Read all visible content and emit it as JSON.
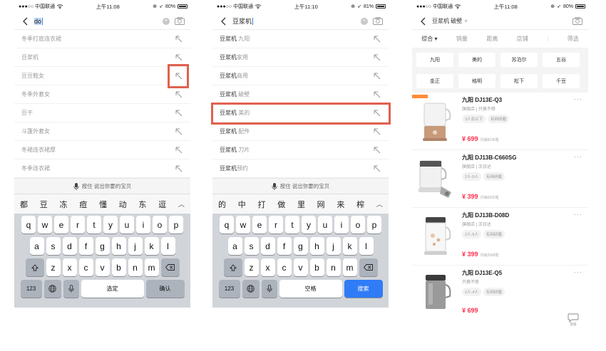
{
  "status": {
    "carrier": "●●●○○ 中国联通",
    "wifi": "wifi"
  },
  "screen1": {
    "time": "上午11:08",
    "battery_text": "80%",
    "battery_level": 0.8,
    "query_typed": "do",
    "suggestions": [
      "冬季打底连衣裙",
      "豆浆机",
      "豆豆鞋女",
      "冬季外套女",
      "豆干",
      "斗篷外套女",
      "冬裙连衣裙厚",
      "冬季连衣裙"
    ],
    "voice_label": "按住 说出你要的宝贝",
    "candidates": [
      "都",
      "豆",
      "冻",
      "痘",
      "懂",
      "动",
      "东",
      "逗"
    ],
    "confirm_label": "选定",
    "ok_label": "确认"
  },
  "screen2": {
    "time": "上午11:10",
    "battery_text": "81%",
    "battery_level": 0.81,
    "query_typed": "豆浆机",
    "suggestions": [
      {
        "kw": "豆浆机",
        "rest": " 九阳"
      },
      {
        "kw": "豆浆机",
        "rest": "家用"
      },
      {
        "kw": "豆浆机",
        "rest": "商用"
      },
      {
        "kw": "豆浆机",
        "rest": " 破壁"
      },
      {
        "kw": "豆浆机",
        "rest": " 美的"
      },
      {
        "kw": "豆浆机",
        "rest": " 配件"
      },
      {
        "kw": "豆浆机",
        "rest": " 刀片"
      },
      {
        "kw": "豆浆机",
        "rest": "预约"
      }
    ],
    "voice_label": "按住 说出你要的宝贝",
    "candidates": [
      "的",
      "中",
      "打",
      "做",
      "里",
      "网",
      "来",
      "榨"
    ],
    "space_label": "空格",
    "search_label": "搜索"
  },
  "keyboard": {
    "row1": [
      "q",
      "w",
      "e",
      "r",
      "t",
      "y",
      "u",
      "i",
      "o",
      "p"
    ],
    "row2": [
      "a",
      "s",
      "d",
      "f",
      "g",
      "h",
      "j",
      "k",
      "l"
    ],
    "row3": [
      "z",
      "x",
      "c",
      "v",
      "b",
      "n",
      "m"
    ],
    "num_label": "123"
  },
  "screen3": {
    "time": "上午11:08",
    "battery_text": "80%",
    "battery_level": 0.8,
    "search_tag": "豆浆机 破壁",
    "sort": [
      "综合 ▾",
      "销量",
      "距离",
      "店铺",
      "筛选"
    ],
    "filters": [
      "九阳",
      "美的",
      "苏泊尔",
      "五谷",
      "金正",
      "格明",
      "松下",
      "千豆"
    ],
    "products": [
      {
        "name": "九阳 DJ13E-Q3",
        "meta": "旗舰店 | 只换不修",
        "tags": [
          "3人及以下",
          "有网研磨"
        ],
        "price": "¥ 699",
        "sold": "月销8236笔"
      },
      {
        "name": "九阳 DJ13B-C660SG",
        "meta": "旗舰店 | 次日达",
        "tags": [
          "2人-5人",
          "有网研磨"
        ],
        "price": "¥ 399",
        "sold": "月销6905笔"
      },
      {
        "name": "九阳 DJ13B-D08D",
        "meta": "旗舰店 | 次日达",
        "tags": [
          "2人-5人",
          "有网研磨"
        ],
        "price": "¥ 399",
        "sold": "月销3968笔"
      },
      {
        "name": "九阳 DJ13E-Q5",
        "meta": "只换不修",
        "tags": [
          "2人-4人",
          "有网研磨"
        ],
        "price": "¥ 699",
        "sold": ""
      }
    ],
    "float_label": "客服"
  }
}
